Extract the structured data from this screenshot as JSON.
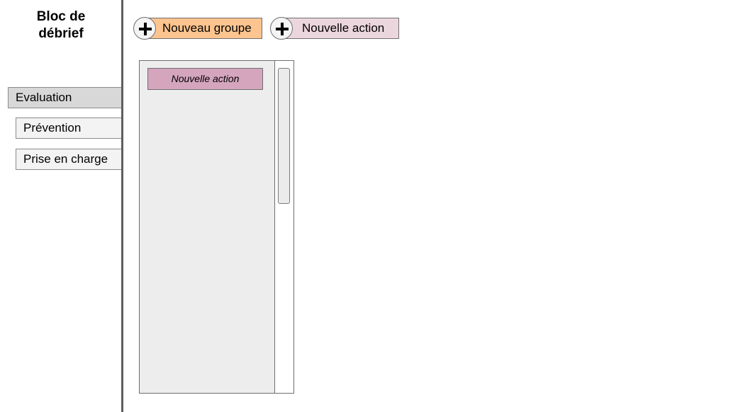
{
  "sidebar": {
    "title": "Bloc de débrief",
    "items": [
      {
        "label": "Evaluation",
        "active": true
      },
      {
        "label": "Prévention",
        "active": false
      },
      {
        "label": "Prise en charge",
        "active": false
      }
    ]
  },
  "toolbar": {
    "new_group_label": "Nouveau groupe",
    "new_action_label": "Nouvelle action",
    "plus_icon": "plus-icon"
  },
  "panel": {
    "actions": [
      {
        "label": "Nouvelle action"
      }
    ]
  },
  "colors": {
    "new_group_button": "#fcc48f",
    "new_action_button": "#ecd6dd",
    "action_card": "#d5a5be",
    "panel_background": "#ededed",
    "active_nav_item": "#d8d8d8"
  }
}
